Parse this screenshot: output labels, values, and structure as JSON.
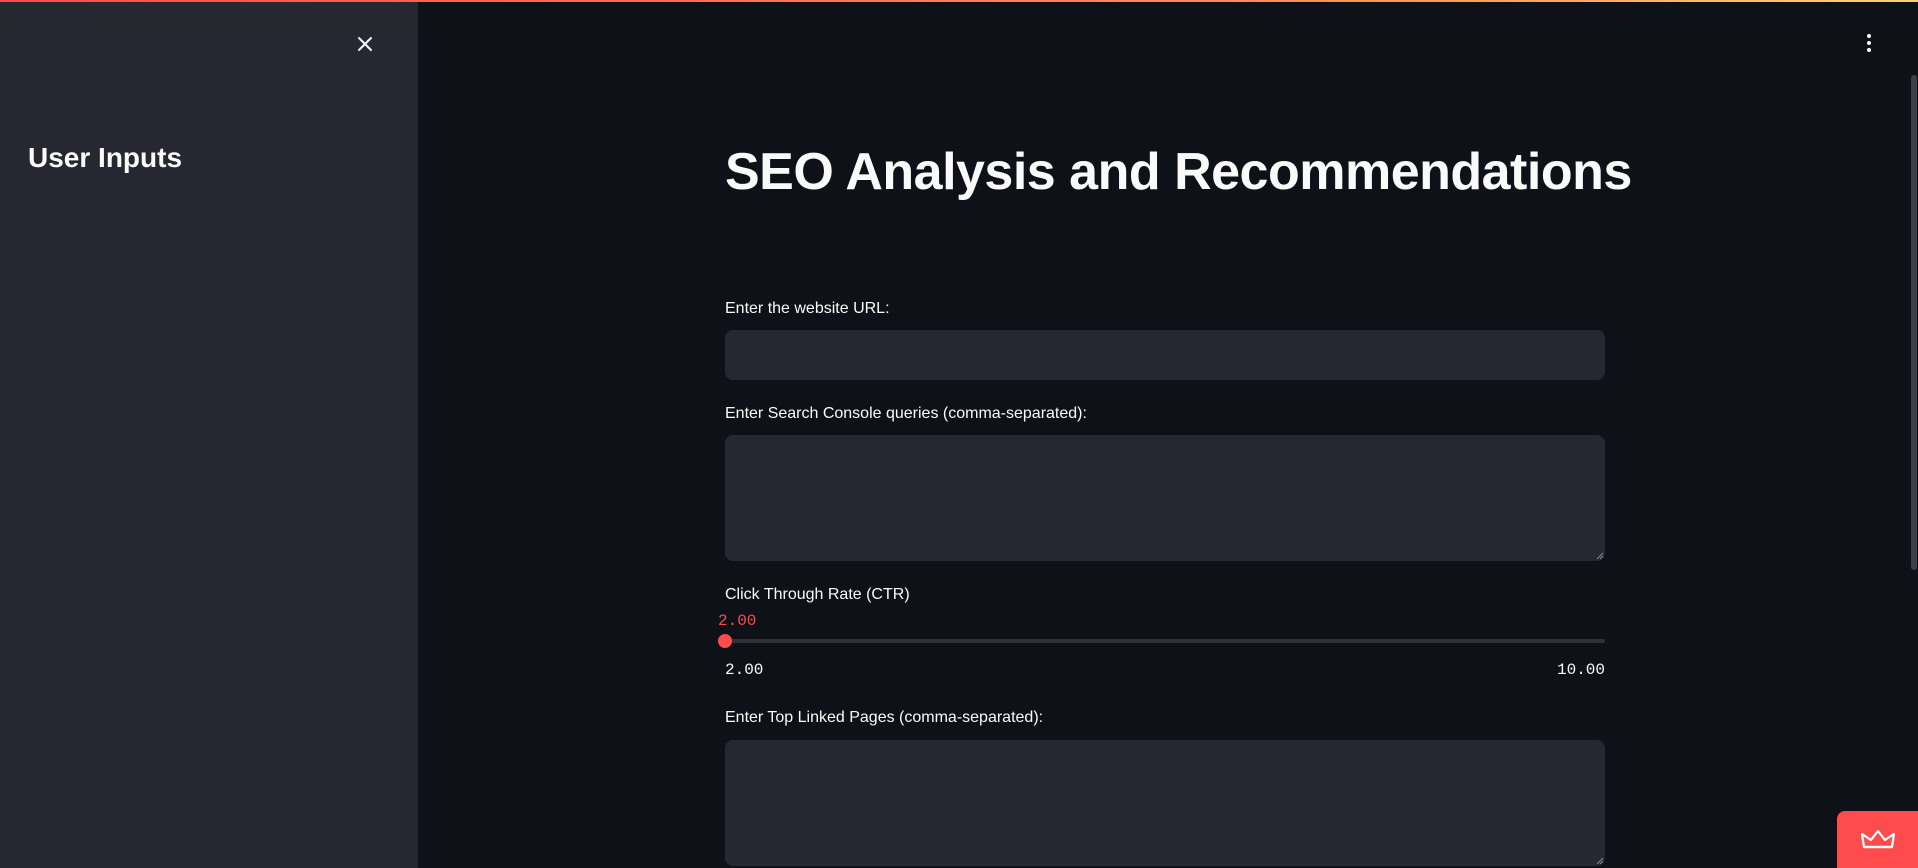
{
  "sidebar": {
    "title": "User Inputs",
    "close_icon": "close-icon"
  },
  "header": {
    "menu_icon": "vertical-ellipsis-icon"
  },
  "main": {
    "title": "SEO Analysis and Recommendations",
    "url_field": {
      "label": "Enter the website URL:",
      "value": "",
      "placeholder": ""
    },
    "queries_field": {
      "label": "Enter Search Console queries (comma-separated):",
      "value": "",
      "placeholder": ""
    },
    "ctr_slider": {
      "label": "Click Through Rate (CTR)",
      "value": "2.00",
      "min": "2.00",
      "max": "10.00",
      "fraction": 0.0
    },
    "top_pages_field": {
      "label": "Enter Top Linked Pages (comma-separated):",
      "value": "",
      "placeholder": ""
    }
  },
  "footer": {
    "badge_icon": "crown-icon"
  },
  "colors": {
    "background": "#0e1117",
    "sidebar": "#262730",
    "input": "#262730",
    "accent": "#ff4b4b",
    "text": "#fafafa"
  }
}
